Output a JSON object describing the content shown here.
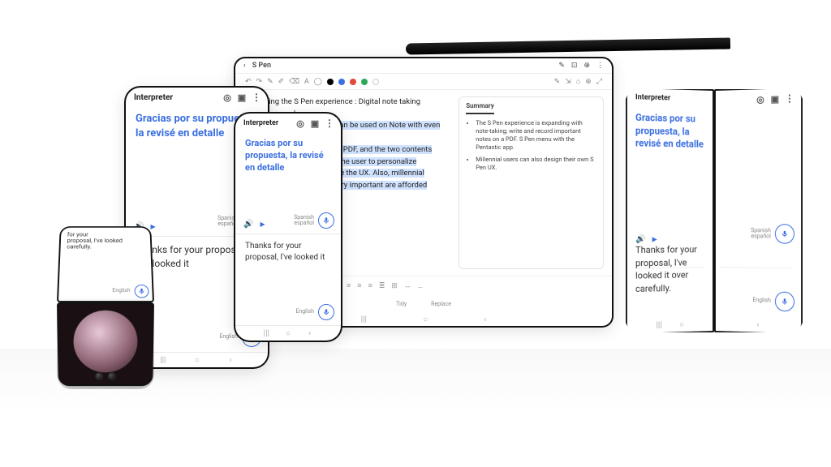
{
  "interpreter": {
    "title": "Interpreter",
    "es_text": "Gracias por su propuesta, la revisé en detalle",
    "en_text_short": "Thanks for your proposal, I've looked it",
    "en_text_full": "Thanks for your proposal, I've looked it over carefully.",
    "en_text_wrap": "for your\nproposal, I've looked\ncarefully.",
    "lang_es": "Spanish",
    "lang_es_sub": "español",
    "lang_en": "English",
    "icons": {
      "target": "◎",
      "window": "▣",
      "more": "⋮",
      "speaker": "🔊",
      "play": "▶"
    }
  },
  "notes": {
    "title": "S Pen",
    "back": "‹",
    "body_line1": "Expanding the S Pen experience : Digital note taking experience and",
    "body_line2": "customizing UX The S Pen can be used on Note with even more freedom.",
    "body_line3": "be written and recorded on a PDF, and the two contents",
    "body_line4": "app called Pentastic allows the user to personalize",
    "body_line5": "that they want and customize the UX. Also, millennial",
    "body_line6": "personal expression to be very important are afforded",
    "body_line7": "gning their own S Pen UX.",
    "summary_title": "Summary",
    "summary1": "The S Pen experience is expanding with note-taking; write and record important notes on a PDF. S Pen menu with the Pentastic app.",
    "summary2": "Millennial users can also design their own S Pen UX.",
    "actions": {
      "tidy": "Tidy",
      "replace": "Replace"
    },
    "toolbar": {
      "icons": [
        "↶",
        "↷",
        "✎",
        "✐",
        "⌫",
        "A",
        "◯"
      ],
      "colors": [
        "#000000",
        "#3a6fe0",
        "#e04a3a",
        "#2aa85a",
        "#ffffff"
      ],
      "right": [
        "✎",
        "⇲",
        "⌂",
        "⊕",
        "⤢"
      ]
    },
    "bottom": [
      "☰",
      "⊞",
      "A",
      "A",
      "B",
      "I",
      "U",
      "S",
      "¶",
      "≡",
      "≡",
      "≡",
      "≣",
      "⊞",
      "↔",
      "…"
    ],
    "header_right": [
      "✎",
      "⊡",
      "⊕",
      "⋮"
    ]
  },
  "nav": {
    "recent": "|||",
    "home": "○",
    "back": "‹"
  }
}
